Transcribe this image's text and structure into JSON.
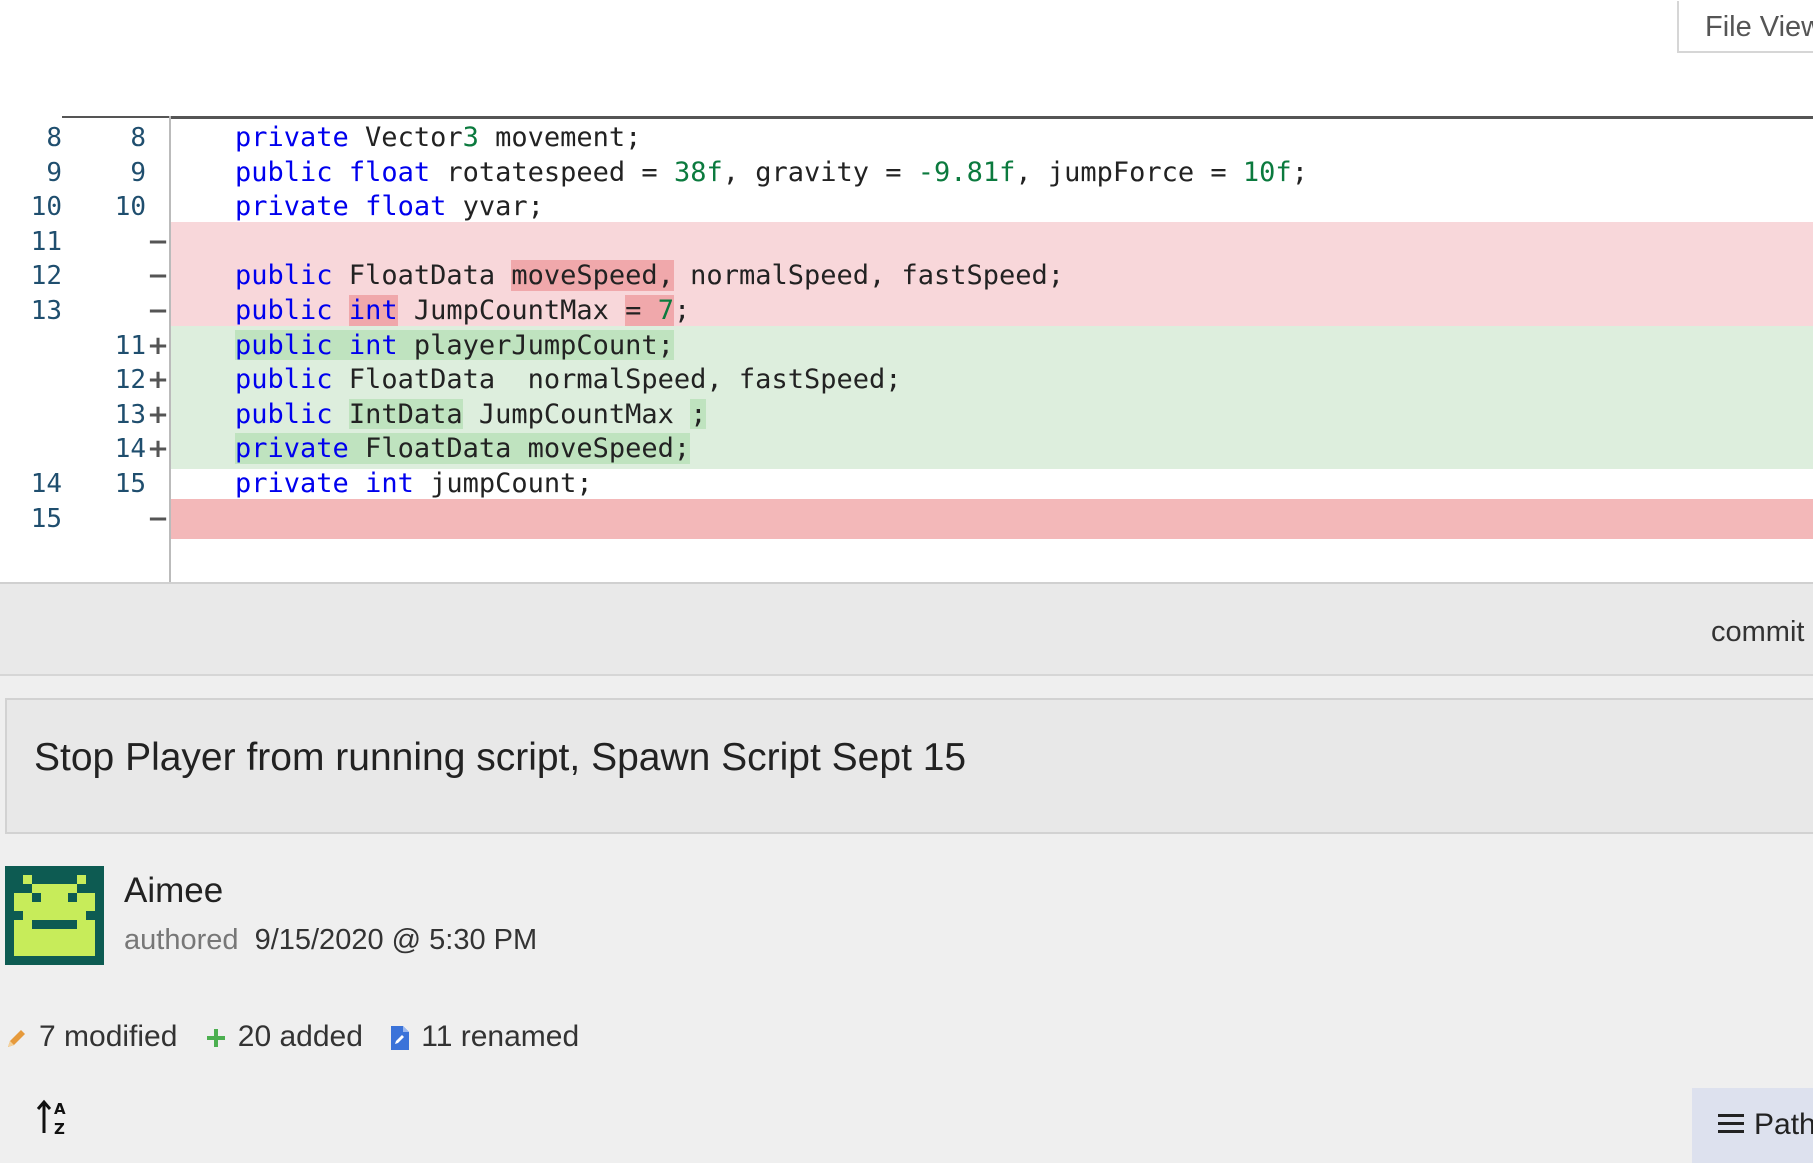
{
  "toolbar": {
    "file_view_label": "File View"
  },
  "diff": {
    "rows": [
      {
        "type": "context",
        "old": "8",
        "new": "8",
        "marker": "",
        "code": "private Vector3 movement;"
      },
      {
        "type": "context",
        "old": "9",
        "new": "9",
        "marker": "",
        "code": "public float rotatespeed = 38f, gravity = -9.81f, jumpForce = 10f;"
      },
      {
        "type": "context",
        "old": "10",
        "new": "10",
        "marker": "",
        "code": "private float yvar;"
      },
      {
        "type": "removed",
        "old": "11",
        "new": "",
        "marker": "−",
        "code": ""
      },
      {
        "type": "removed",
        "old": "12",
        "new": "",
        "marker": "−",
        "code": "public FloatData moveSpeed, normalSpeed, fastSpeed;"
      },
      {
        "type": "removed",
        "old": "13",
        "new": "",
        "marker": "−",
        "code": "public int JumpCountMax = 7;"
      },
      {
        "type": "added",
        "old": "",
        "new": "11",
        "marker": "+",
        "code": "public int playerJumpCount;"
      },
      {
        "type": "added",
        "old": "",
        "new": "12",
        "marker": "+",
        "code": "public FloatData  normalSpeed, fastSpeed;"
      },
      {
        "type": "added",
        "old": "",
        "new": "13",
        "marker": "+",
        "code": "public IntData JumpCountMax ;"
      },
      {
        "type": "added",
        "old": "",
        "new": "14",
        "marker": "+",
        "code": "private FloatData moveSpeed;"
      },
      {
        "type": "context",
        "old": "14",
        "new": "15",
        "marker": "",
        "code": "private int jumpCount;"
      },
      {
        "type": "removed",
        "old": "15",
        "new": "",
        "marker": "−",
        "code": ""
      }
    ]
  },
  "commit": {
    "bar_label": "commit",
    "message": "Stop Player from running script, Spawn Script Sept 15",
    "author": "Aimee",
    "authored_label": "authored",
    "date": "9/15/2020 @ 5:30 PM"
  },
  "stats": {
    "modified": "7 modified",
    "added": "20 added",
    "renamed": "11 renamed"
  },
  "bottom": {
    "path_label": "Path"
  },
  "colors": {
    "keyword": "#0000ee",
    "number": "#0b7a3e",
    "removed_bg": "#f8d7da",
    "added_bg": "#ddeedd"
  },
  "icons": [
    "pencil-icon",
    "plus-icon",
    "renamed-file-icon",
    "sort-az-icon",
    "hamburger-icon"
  ]
}
